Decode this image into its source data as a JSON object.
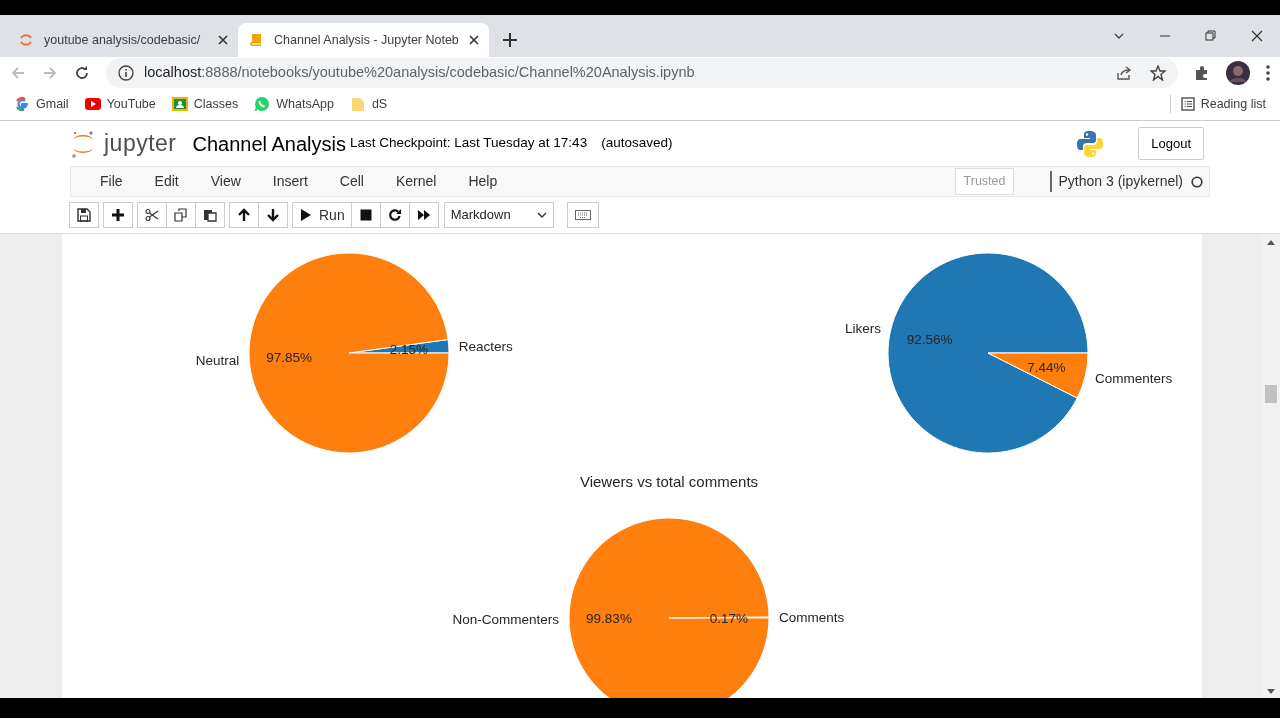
{
  "browser": {
    "tabs": [
      {
        "title": "youtube analysis/codebasic/",
        "kind": "spinner",
        "selected": false
      },
      {
        "title": "Channel Analysis - Jupyter Noteb",
        "kind": "book",
        "selected": true
      }
    ],
    "address": {
      "host": "localhost",
      "path": ":8888/notebooks/youtube%20analysis/codebasic/Channel%20Analysis.ipynb"
    },
    "bookmarks": [
      {
        "label": "Gmail",
        "kind": "google"
      },
      {
        "label": "YouTube",
        "kind": "youtube"
      },
      {
        "label": "Classes",
        "kind": "classroom"
      },
      {
        "label": "WhatsApp",
        "kind": "whatsapp"
      },
      {
        "label": "dS",
        "kind": "folder"
      }
    ],
    "reading_list": "Reading list"
  },
  "jupyter": {
    "logo_text": "jupyter",
    "notebook_name": "Channel Analysis",
    "checkpoint": "Last Checkpoint: Last Tuesday at 17:43",
    "autosave": "(autosaved)",
    "logout": "Logout",
    "menu": [
      "File",
      "Edit",
      "View",
      "Insert",
      "Cell",
      "Kernel",
      "Help"
    ],
    "trusted": "Trusted",
    "kernel": "Python 3 (ipykernel)",
    "toolbar": [
      [
        {
          "kind": "save"
        }
      ],
      [
        {
          "kind": "add"
        }
      ],
      [
        {
          "kind": "cut"
        },
        {
          "kind": "copy"
        },
        {
          "kind": "paste"
        }
      ],
      [
        {
          "kind": "up"
        },
        {
          "kind": "down"
        }
      ],
      [
        {
          "kind": "run",
          "label": "Run"
        },
        {
          "kind": "stop"
        },
        {
          "kind": "restart"
        },
        {
          "kind": "fastforward"
        }
      ]
    ],
    "cell_type": "Markdown"
  },
  "output": {
    "charts": [
      {
        "chart_data": {
          "type": "pie",
          "categories": [
            "Reacters",
            "Neutral"
          ],
          "values": [
            2.15,
            97.85
          ],
          "colors": [
            "#1f77b4",
            "#ff7f0e"
          ],
          "value_labels": [
            "2.15%",
            "97.85%"
          ]
        }
      },
      {
        "chart_data": {
          "type": "pie",
          "categories": [
            "Likers",
            "Commenters"
          ],
          "values": [
            92.56,
            7.44
          ],
          "colors": [
            "#1f77b4",
            "#ff7f0e"
          ],
          "value_labels": [
            "92.56%",
            "7.44%"
          ]
        }
      },
      {
        "chart_data": {
          "type": "pie",
          "title": "Viewers vs total comments",
          "categories": [
            "Comments",
            "Non-Commenters"
          ],
          "values": [
            0.17,
            99.83
          ],
          "colors": [
            "#1f77b4",
            "#ff7f0e"
          ],
          "value_labels": [
            "0.17%",
            "99.83%"
          ]
        }
      }
    ]
  }
}
